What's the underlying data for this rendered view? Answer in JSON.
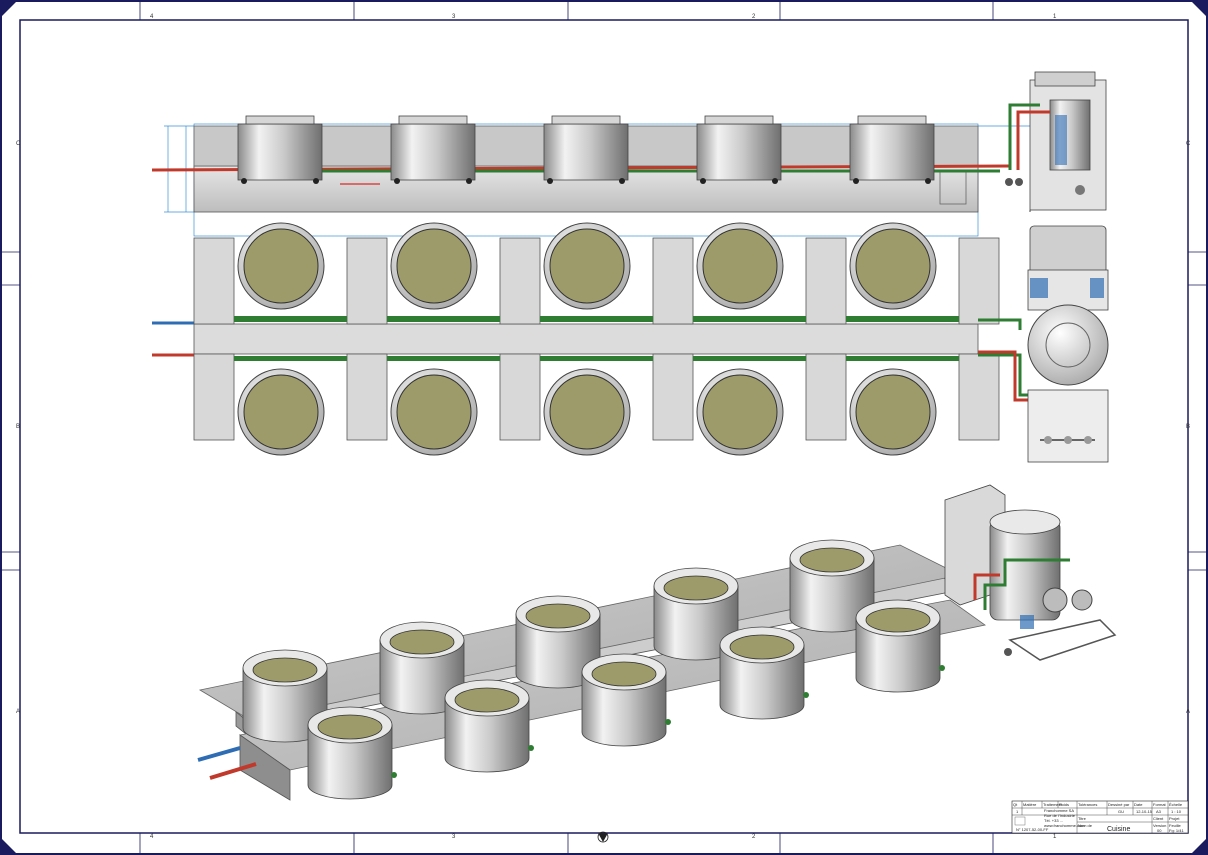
{
  "sheet": {
    "zones_top": [
      "4",
      "3",
      "2",
      "1"
    ],
    "zones_side": [
      "C",
      "B",
      "A"
    ],
    "view_counts": {
      "top_pots": 5,
      "plan_pots_per_row": 5,
      "iso_pots": 10
    }
  },
  "title_block": {
    "row1_headers": [
      "Qt",
      "Matière",
      "Traitement",
      "Poids",
      "Tolérances",
      "Dessiné par",
      "Date",
      "Format",
      "Échelle"
    ],
    "row1_values": [
      "1",
      "",
      "",
      "",
      "",
      "GU",
      "12-10-15",
      "A3",
      "1 : 10"
    ],
    "company_lines": [
      "Franchomme SA",
      "Rue de l'Industrie",
      "Tél. +33 ...",
      "www.franchomme.com"
    ],
    "drawing_number": "N° 1207-52-00-FF",
    "title_label": "Titre",
    "title_value": "Cuisine",
    "version_label": "Version",
    "version_value": "00",
    "folio_label": "Feuille",
    "folio_value": "Fg: 1/41",
    "client_label": "Client",
    "project_label": "Projet",
    "name_label": "Nom de"
  },
  "colors": {
    "frame": "#1a1a5e",
    "steel": "#d4d4d4",
    "pot_fill": "#9e9b6a",
    "pipe_red": "#c0392b",
    "pipe_green": "#2e7d32",
    "pipe_blue": "#2e6db4",
    "dim_blue": "#3a8fd6"
  }
}
